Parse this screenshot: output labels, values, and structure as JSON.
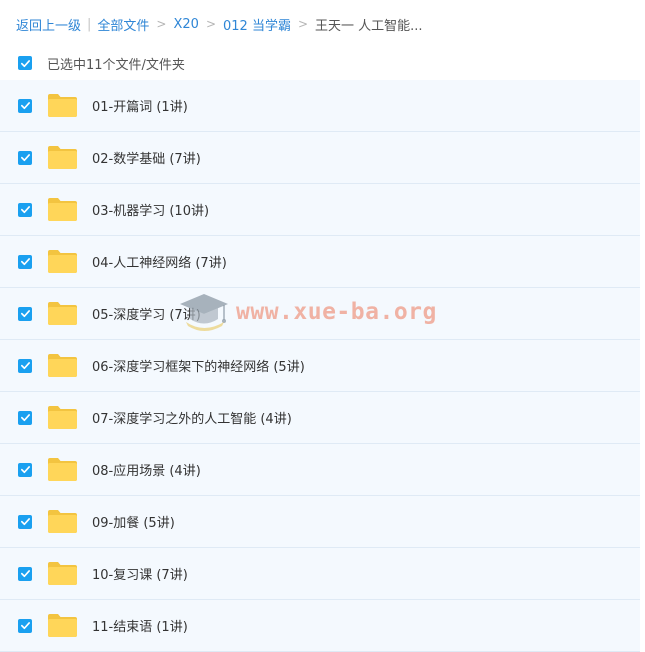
{
  "breadcrumb": {
    "back": "返回上一级",
    "separator": "|",
    "all_files": "全部文件",
    "crumbs": [
      "X20",
      "012 当学霸"
    ],
    "current": "王天一 人工智能..."
  },
  "selection": {
    "label": "已选中11个文件/文件夹"
  },
  "folders": [
    {
      "name": "01-开篇词 (1讲)"
    },
    {
      "name": "02-数学基础 (7讲)"
    },
    {
      "name": "03-机器学习 (10讲)"
    },
    {
      "name": "04-人工神经网络 (7讲)"
    },
    {
      "name": "05-深度学习 (7讲)"
    },
    {
      "name": "06-深度学习框架下的神经网络 (5讲)"
    },
    {
      "name": "07-深度学习之外的人工智能 (4讲)"
    },
    {
      "name": "08-应用场景 (4讲)"
    },
    {
      "name": "09-加餐 (5讲)"
    },
    {
      "name": "10-复习课 (7讲)"
    },
    {
      "name": "11-结束语 (1讲)"
    }
  ],
  "watermark": {
    "text": "www.xue-ba.org",
    "icon": "graduation-cap-icon"
  },
  "colors": {
    "accent": "#1aa0f0",
    "link": "#2f86d6",
    "folder": "#ffd659",
    "row_bg": "#f4f9fe"
  }
}
